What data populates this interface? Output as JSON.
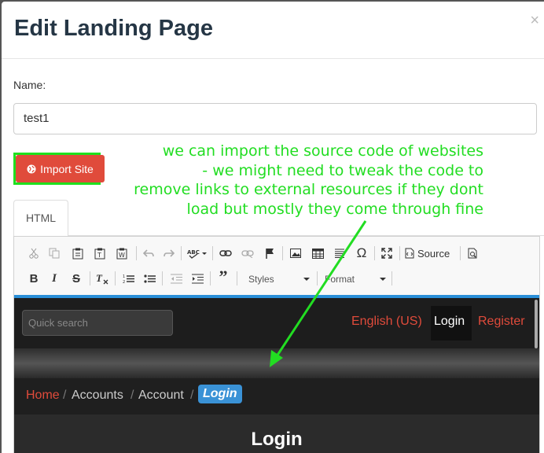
{
  "modal": {
    "title": "Edit Landing Page",
    "close": "×"
  },
  "form": {
    "name_label": "Name:",
    "name_value": "test1",
    "import_button": "Import Site"
  },
  "annotation": {
    "lines": [
      "we can import the source code of websites",
      "- we might need to tweak the code to",
      "remove links to external resources if they dont",
      "load but mostly they come through fine"
    ],
    "color": "#22dd22"
  },
  "tabs": [
    {
      "label": "HTML"
    }
  ],
  "toolbar": {
    "source_label": "Source",
    "styles_label": "Styles",
    "format_label": "Format"
  },
  "preview": {
    "search_placeholder": "Quick search",
    "nav": {
      "language": "English (US)",
      "login": "Login",
      "register": "Register"
    },
    "breadcrumb": {
      "home": "Home",
      "sep": "/",
      "accounts": "Accounts",
      "account": "Account",
      "active": "Login"
    },
    "page_title": "Login"
  },
  "colors": {
    "accent_red": "#e04b3b",
    "accent_blue": "#3a92d6",
    "title_color": "#253645"
  }
}
